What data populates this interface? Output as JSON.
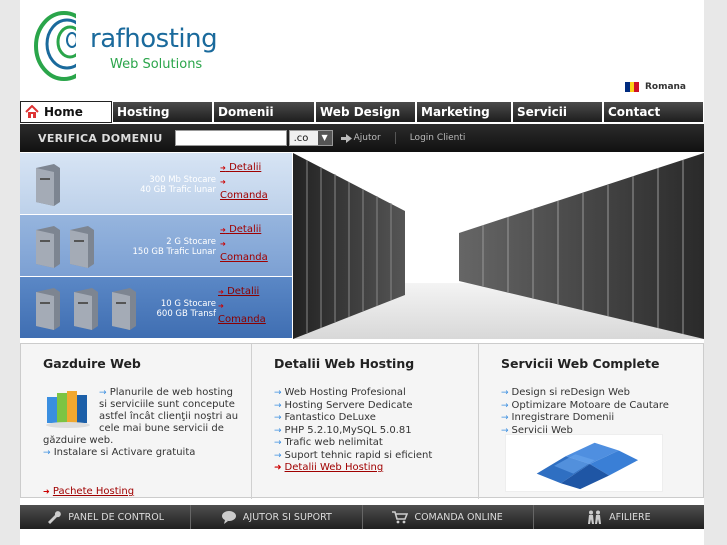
{
  "brand": {
    "name": "rafhosting",
    "tagline": "Web Solutions"
  },
  "language": {
    "label": "Romana",
    "flag_colors": [
      "#002b7f",
      "#fcd116",
      "#ce1126"
    ]
  },
  "nav": {
    "items": [
      {
        "label": "Home"
      },
      {
        "label": "Hosting"
      },
      {
        "label": "Domenii"
      },
      {
        "label": "Web Design"
      },
      {
        "label": "Marketing"
      },
      {
        "label": "Servicii"
      },
      {
        "label": "Contact"
      }
    ]
  },
  "domain_bar": {
    "label": "VERIFICA DOMENIU",
    "input_value": "",
    "tld": ".co",
    "help_label": "Ajutor",
    "login_label": "Login Clienti"
  },
  "packages": [
    {
      "line1": "300 Mb Stocare",
      "line2": "40 GB Trafic lunar",
      "details": "Detalii",
      "order": "Comanda"
    },
    {
      "line1": "2 G Stocare",
      "line2": "150 GB Trafic Lunar",
      "details": "Detalii",
      "order": "Comanda"
    },
    {
      "line1": "10 G Stocare",
      "line2": "600 GB Transf",
      "details": "Detalii",
      "order": "Comanda"
    }
  ],
  "columns": {
    "gazduire": {
      "title": "Gazduire Web",
      "text": "Planurile de web hosting si serviciile sunt concepute astfel încât clienţii noştri au cele mai bune servicii de găzduire web.",
      "extra": "Instalare si Activare gratuita",
      "link": "Pachete Hosting"
    },
    "detalii": {
      "title": "Detalii Web Hosting",
      "items": [
        "Web Hosting Profesional",
        "Hosting Servere Dedicate",
        "Fantastico DeLuxe",
        "PHP 5.2.10,MySQL 5.0.81",
        "Trafic web nelimitat",
        "Suport tehnic rapid si eficient"
      ],
      "link": "Detalii Web Hosting"
    },
    "servicii": {
      "title": "Servicii Web Complete",
      "items": [
        "Design si reDesign Web",
        "Optimizare Motoare de Cautare",
        "Inregistrare Domenii",
        "Servicii Web"
      ]
    }
  },
  "footer": {
    "items": [
      {
        "label": "PANEL DE CONTROL",
        "icon": "wrench-icon"
      },
      {
        "label": "AJUTOR SI SUPORT",
        "icon": "chat-bubble-icon"
      },
      {
        "label": "COMANDA ONLINE",
        "icon": "cart-icon"
      },
      {
        "label": "AFILIERE",
        "icon": "people-icon"
      }
    ]
  },
  "colors": {
    "accent_link": "#a00000",
    "nav_dark": "#1d1d1d",
    "pkg_blue": "#3f6eb2"
  }
}
